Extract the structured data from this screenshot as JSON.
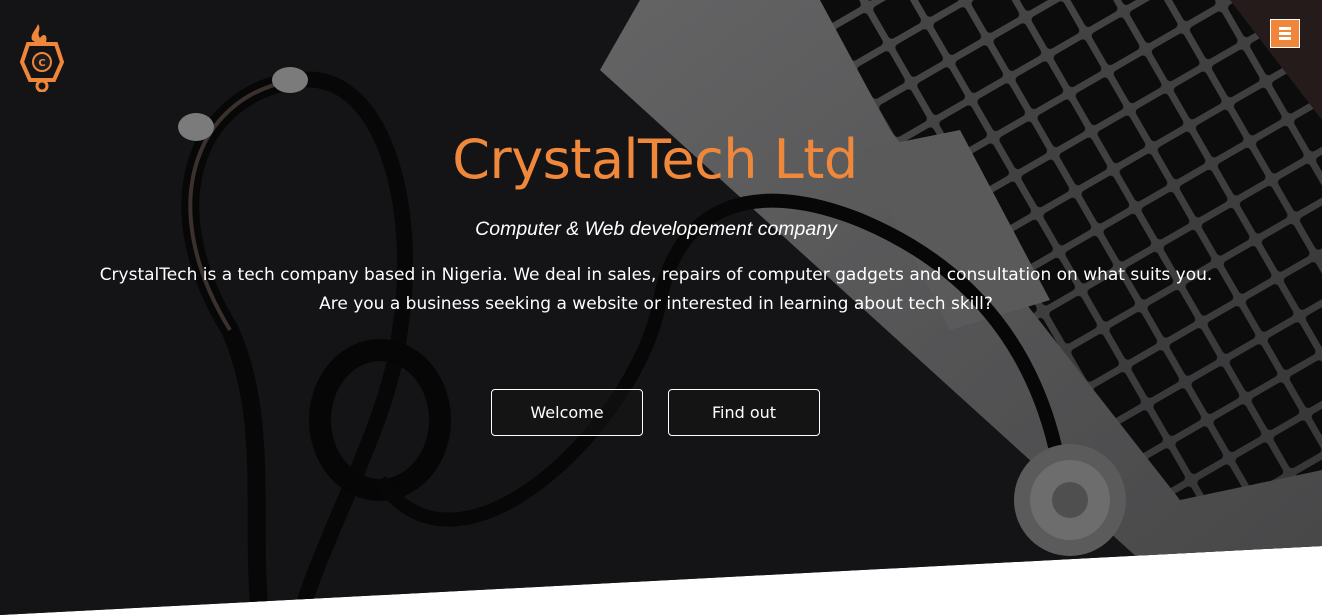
{
  "brand": {
    "logo_icon": "crystaltech-flame-logo-icon",
    "logo_letter": "C",
    "accent_color": "#f0863a"
  },
  "nav": {
    "menu_icon": "hamburger-menu-icon"
  },
  "hero": {
    "title": "CrystalTech Ltd",
    "subtitle": "Computer & Web developement company",
    "description_line1": "CrystalTech is a tech company based in Nigeria. We deal in sales, repairs of computer gadgets and consultation on what suits you.",
    "description_line2": "Are you a business seeking a website or interested in learning about tech skill?",
    "buttons": {
      "welcome": "Welcome",
      "find_out": "Find out"
    }
  }
}
